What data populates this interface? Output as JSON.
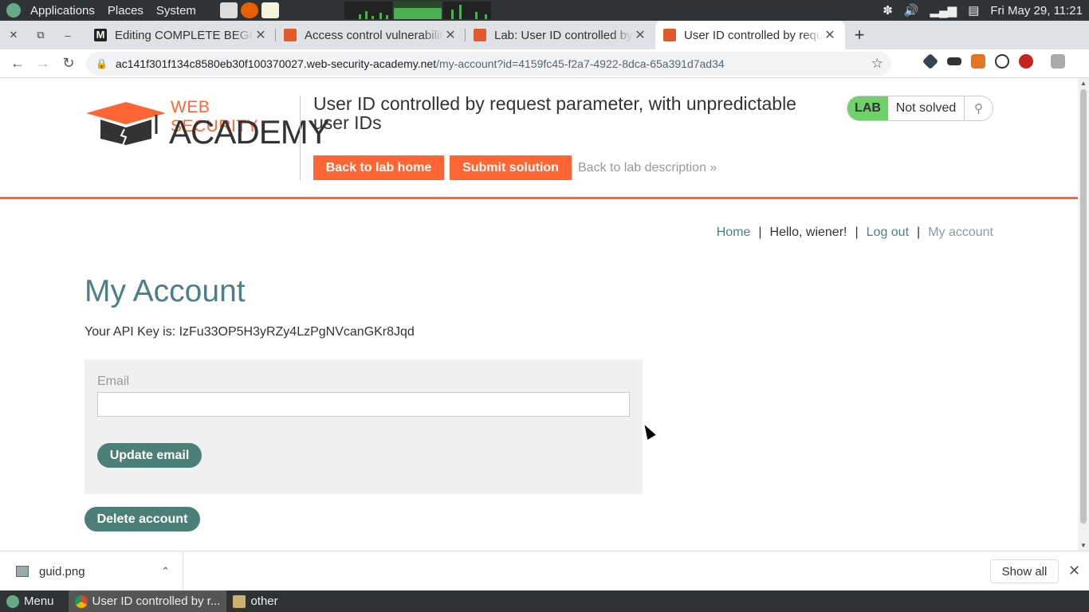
{
  "os_panel": {
    "menus": [
      "Applications",
      "Places",
      "System"
    ],
    "clock": "Fri May 29, 11:21"
  },
  "tabs": [
    {
      "title": "Editing COMPLETE BEGIN",
      "favicon_color": "#222222",
      "favicon_letter": "M"
    },
    {
      "title": "Access control vulnerabiliti",
      "favicon_color": "#e05a2b"
    },
    {
      "title": "Lab: User ID controlled by",
      "favicon_color": "#e05a2b"
    },
    {
      "title": "User ID controlled by requ",
      "favicon_color": "#e05a2b",
      "active": true
    }
  ],
  "address": {
    "host": "ac141f301f134c8580eb30f100370027.web-security-academy.net",
    "path": "/my-account?id=4159fc45-f2a7-4922-8dca-65a391d7ad34"
  },
  "lab": {
    "logo_top": "WEB SECURITY",
    "logo_bottom": "ACADEMY",
    "title": "User ID controlled by request parameter, with unpredictable user IDs",
    "back_home": "Back to lab home",
    "submit": "Submit solution",
    "back_desc": "Back to lab description »",
    "badge_lab": "LAB",
    "badge_status": "Not solved",
    "accent": "#ff6633",
    "status_color": "#70d16b"
  },
  "nav": {
    "home": "Home",
    "hello": "Hello, wiener!",
    "logout": "Log out",
    "account": "My account",
    "sep": "|"
  },
  "account": {
    "heading": "My Account",
    "api_key": "Your API Key is: IzFu33OP5H3yRZy4LzPgNVcanGKr8Jqd",
    "email_label": "Email",
    "email_value": "",
    "update": "Update email",
    "delete": "Delete account",
    "theme": "#4d7f79"
  },
  "download": {
    "file": "guid.png",
    "show_all": "Show all"
  },
  "taskbar": {
    "menu": "Menu",
    "tasks": [
      "User ID controlled by r...",
      "other"
    ]
  }
}
